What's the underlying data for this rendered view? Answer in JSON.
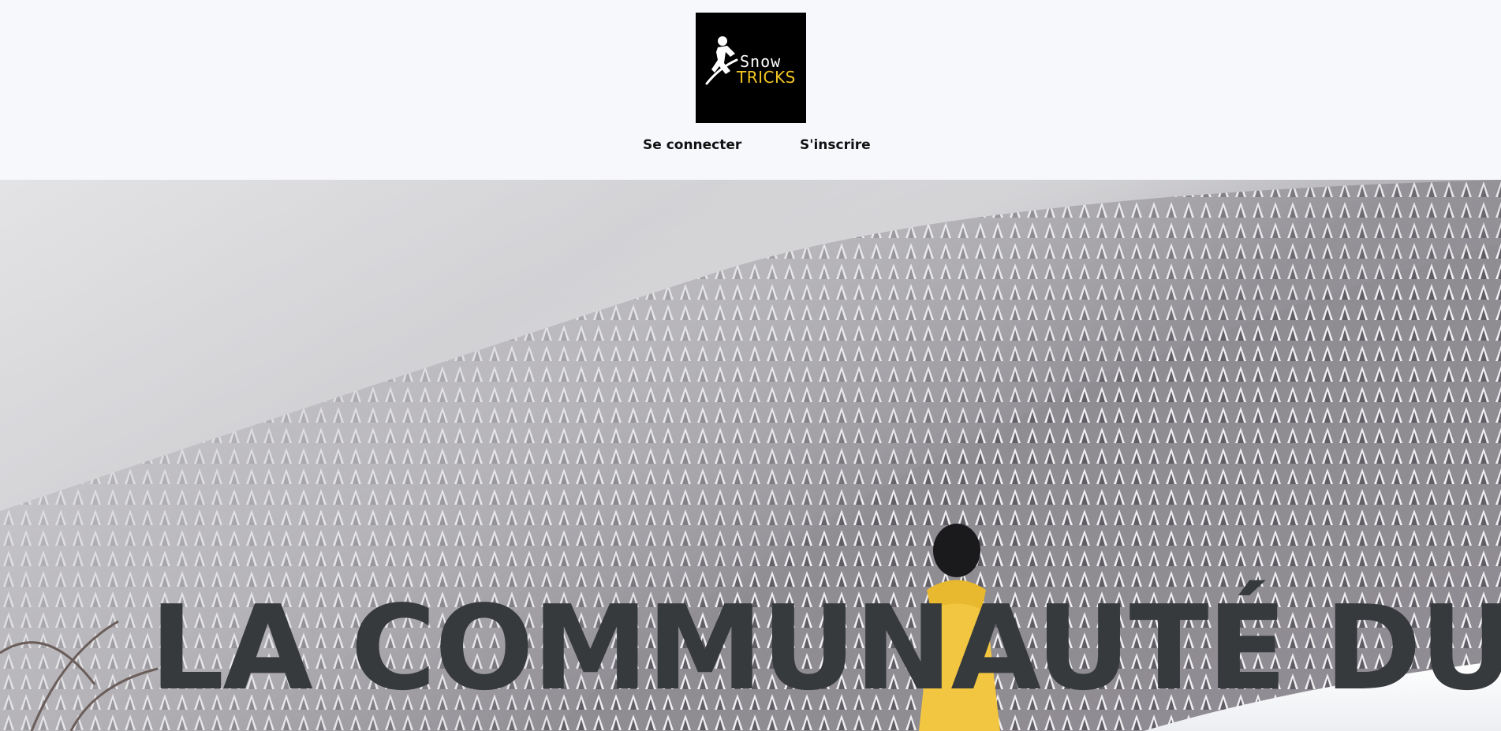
{
  "header": {
    "logo": {
      "line1": "Snow",
      "line2": "TRICKS",
      "icon": "snowboarder-icon",
      "background_color": "#000000",
      "line1_color": "#ffffff",
      "line2_color": "#f3c623"
    },
    "nav": {
      "login_label": "Se connecter",
      "signup_label": "S'inscrire"
    }
  },
  "hero": {
    "title": "LA COMMUNAUTÉ DU",
    "title_color": "#363a3d",
    "jacket_color": "#f2c640"
  }
}
